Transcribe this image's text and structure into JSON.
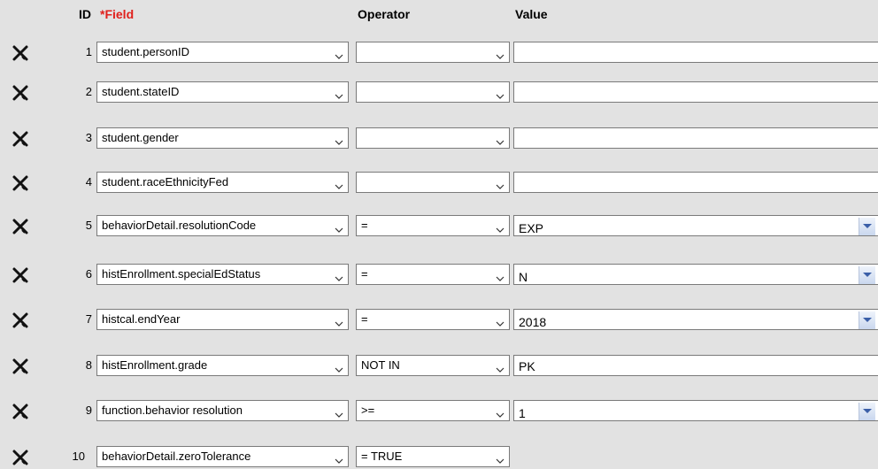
{
  "header": {
    "id_label": "ID",
    "field_label": "*Field",
    "operator_label": "Operator",
    "value_label": "Value"
  },
  "icons": {
    "delete": "close-icon",
    "dropdown": "chevron-down-icon"
  },
  "colors": {
    "required": "#e0201c",
    "background": "#e2e2e2",
    "dropdown_arrow": "#3b5fa8"
  },
  "rows": [
    {
      "id": "1",
      "field": "student.personID",
      "operator": "",
      "value": "",
      "value_dropdown": false
    },
    {
      "id": "2",
      "field": "student.stateID",
      "operator": "",
      "value": "",
      "value_dropdown": false
    },
    {
      "id": "3",
      "field": "student.gender",
      "operator": "",
      "value": "",
      "value_dropdown": false
    },
    {
      "id": "4",
      "field": "student.raceEthnicityFed",
      "operator": "",
      "value": "",
      "value_dropdown": false
    },
    {
      "id": "5",
      "field": "behaviorDetail.resolutionCode",
      "operator": "=",
      "value": "EXP",
      "value_dropdown": true
    },
    {
      "id": "6",
      "field": "histEnrollment.specialEdStatus",
      "operator": "=",
      "value": "N",
      "value_dropdown": true
    },
    {
      "id": "7",
      "field": "histcal.endYear",
      "operator": "=",
      "value": "2018",
      "value_dropdown": true
    },
    {
      "id": "8",
      "field": "histEnrollment.grade",
      "operator": "NOT IN",
      "value": "PK",
      "value_dropdown": false
    },
    {
      "id": "9",
      "field": "function.behavior resolution",
      "operator": ">=",
      "value": "1",
      "value_dropdown": true
    },
    {
      "id": "10",
      "field": "behaviorDetail.zeroTolerance",
      "operator": "= TRUE",
      "value": null,
      "value_dropdown": false
    }
  ]
}
